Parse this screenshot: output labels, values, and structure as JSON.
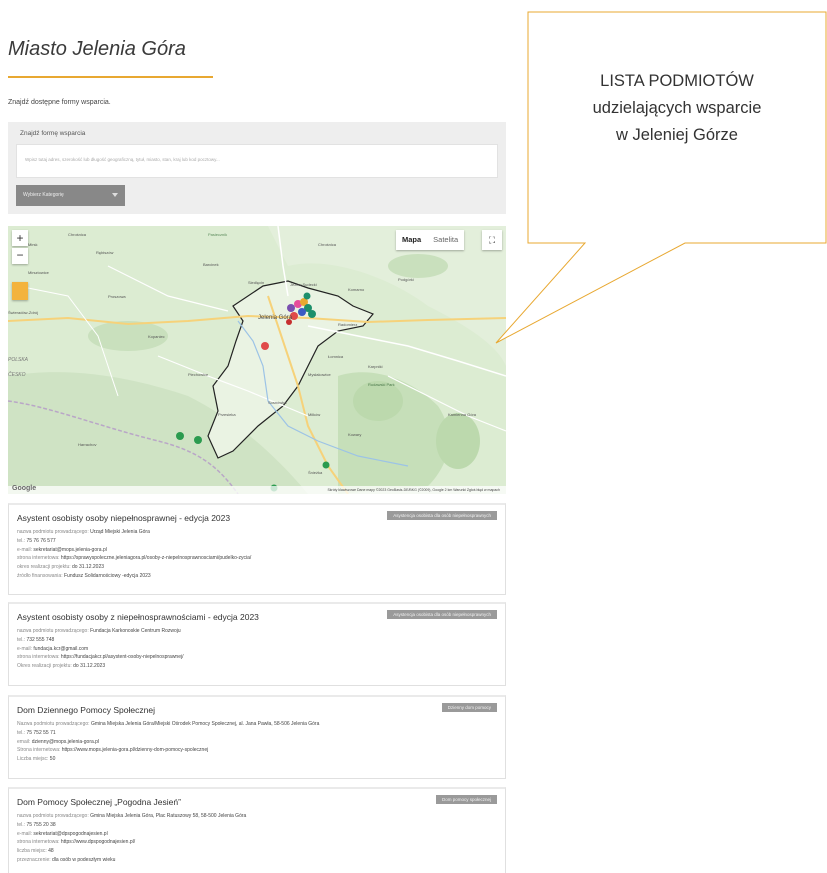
{
  "page": {
    "title": "Miasto Jelenia Góra",
    "intro": "Znajdź dostępne formy wsparcia."
  },
  "search": {
    "label": "Znajdź formę wsparcia",
    "placeholder": "Wpisz tutaj adres, szerokość lub długość geograficzną, tytuł, miasto, stan, kraj lub kod pocztowy...",
    "category": "Wybierz Kategorię"
  },
  "map": {
    "type_map": "Mapa",
    "type_satellite": "Satelita",
    "zoom_in": "+",
    "zoom_out": "−",
    "google": "Google",
    "footer": "Skróty klawiszowe   Dane mapy ©2023 GeoBasis-DE/BKG (©2009), Google   2 km   Warunki   Zgłoś błąd w mapach",
    "places": [
      "Jelenia Góra",
      "Chrośnica",
      "Pasiecznik",
      "Barcinek",
      "Siedlęcin",
      "Jeżów Sudecki",
      "Dziwiszów",
      "Komarno",
      "Podgórki",
      "Wojcieszów",
      "Radomierz",
      "Kaczorów",
      "Mirsk",
      "Rębiszów",
      "Gryfów",
      "Mirsztowice",
      "Proszowa",
      "Stara Kamienica",
      "Kopaniec",
      "Świeradów-Zdrój",
      "Chromiec",
      "Wojcieszyce",
      "Łomnica",
      "Karpniki",
      "Mysłakowice",
      "Bukowiec",
      "Piechowice",
      "Staniszów",
      "Przesieka",
      "Sosnówka",
      "Miłków",
      "Kowary",
      "Szklarska Poręba",
      "Jakuszyce",
      "Borowice",
      "Karpacz",
      "Ściegny",
      "Przełęcz",
      "Kamienna Góra",
      "Marciszów",
      "Wieściszowice",
      "Janowice Wielkie",
      "Pisarzowice",
      "Kostrzyca",
      "Sędzisław",
      "Rudawski Park Krajobrazowy",
      "Karkonoski Park Narodowy",
      "Polska",
      "Česko",
      "Harrachov",
      "Kořenov",
      "Szrenica",
      "Śnieżka",
      "Paczyn",
      "Czarny Kocioł"
    ]
  },
  "cards": [
    {
      "title": "Asystent osobisty osoby niepełnosprawnej - edycja 2023",
      "badge": "Asystencja osobista dla osób niepełnosprawnych",
      "lines": [
        {
          "label": "nazwa podmiotu prowadzącego: ",
          "value": "Urząd Miejski Jelenia Góra"
        },
        {
          "label": "tel.: ",
          "value": "75 76 76 577"
        },
        {
          "label": "e-mail: ",
          "value": "sekretariat@mops.jelenia-gora.pl"
        },
        {
          "label": "strona internetowa: ",
          "value": "https://sprawyspoleczne.jeleniagora.pl/osoby-z-niepelnosprawnosciami/pudelko-zycia/"
        },
        {
          "label": "okres realizacji projektu: ",
          "value": "do 31.12.2023"
        },
        {
          "label": "źródło finansowania: ",
          "value": "Fundusz Solidarnościowy -edycja 2023"
        }
      ]
    },
    {
      "title": "Asystent osobisty osoby z niepełnosprawnościami - edycja 2023",
      "badge": "Asystencja osobista dla osób niepełnosprawnych",
      "lines": [
        {
          "label": "nazwa podmiotu prowadzącego: ",
          "value": "Fundacja Karkonoskie Centrum Rozwoju"
        },
        {
          "label": "tel.: ",
          "value": "732 555 748"
        },
        {
          "label": "e-mail: ",
          "value": "fundacja.kcr@gmail.com"
        },
        {
          "label": "strona internetowa: ",
          "value": "https://fundacjakcr.pl/asystent-osoby-niepelnosprawnej/"
        },
        {
          "label": "Okres realizacji projektu: ",
          "value": "do 31.12.2023"
        }
      ]
    },
    {
      "title": "Dom Dziennego Pomocy Społecznej",
      "badge": "Dzienny dom pomocy",
      "lines": [
        {
          "label": "Nazwa podmiotu prowadzącego: ",
          "value": "Gmina Miejska Jelenia Góra/Miejski Ośrodek Pomocy Społecznej, al. Jana Pawła, 58-506 Jelenia Góra"
        },
        {
          "label": "tel.: ",
          "value": "75 752 55 71"
        },
        {
          "label": "email: ",
          "value": "dzienny@mops.jelenia-gora.pl"
        },
        {
          "label": "Strona internetowa: ",
          "value": "https://www.mops.jelenia-gora.pl/dzienny-dom-pomocy-spolecznej"
        },
        {
          "label": "Liczba miejsc: ",
          "value": "50"
        }
      ]
    },
    {
      "title": "Dom Pomocy Społecznej „Pogodna Jesień”",
      "badge": "Dom pomocy społecznej",
      "lines": [
        {
          "label": "nazwa podmiotu prowadzącego: ",
          "value": "Gmina Miejska Jelenia Góra, Plac Ratuszowy 58, 58-500 Jelenia Góra"
        },
        {
          "label": "tel.: ",
          "value": "75 755 20 38"
        },
        {
          "label": "e-mail: ",
          "value": "sekretariat@dpspogodnajesien.pl"
        },
        {
          "label": "strona internetowa: ",
          "value": "https://www.dpspogodnajesien.pl/"
        },
        {
          "label": "liczba miejsc: ",
          "value": "48"
        },
        {
          "label": "przeznaczenie: ",
          "value": "dla osób w podeszłym wieku"
        }
      ]
    }
  ],
  "callout": {
    "line1": "LISTA PODMIOTÓW",
    "line2": "udzielających wsparcie",
    "line3": "w Jeleniej Górze"
  },
  "colors": {
    "accent": "#e8a831",
    "badge": "#9a9a9a",
    "map_land": "#d9ebcf"
  }
}
